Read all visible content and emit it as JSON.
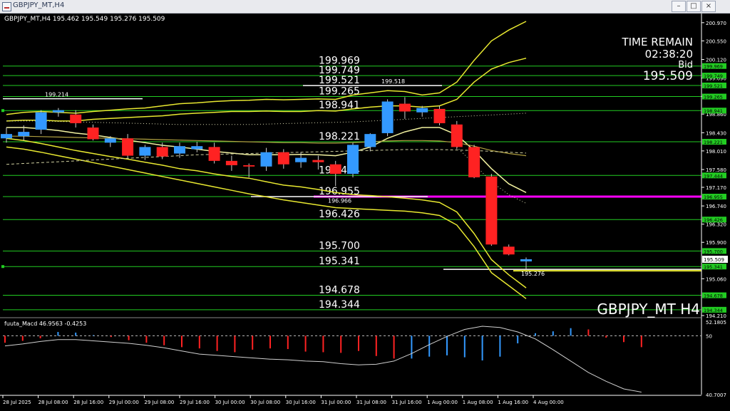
{
  "window": {
    "title": "GBPJPY_MT,H4",
    "min_symbol": "–",
    "max_symbol": "□",
    "close_symbol": "×"
  },
  "main_header": "GBPJPY_MT,H4  195.462 195.549 195.276 195.509",
  "watermark": "GBPJPY_MT H4",
  "info_panel": {
    "label1": "TIME REMAIN",
    "value1": "02:38:20",
    "label2": "Bid",
    "value2": "195.509"
  },
  "macd_header": "fuuta_Macd 46.9563  -0.4253",
  "colors": {
    "bull": "#3399ff",
    "bear": "#ff2222",
    "level": "#22cc22",
    "band": "#e8e830",
    "magenta": "#ff00ff",
    "bg": "#000000",
    "grid_text": "#ffffff"
  },
  "chart_data": {
    "type": "candlestick",
    "symbol": "GBPJPY_MT",
    "timeframe": "H4",
    "ylim": [
      194.21,
      201.0
    ],
    "price_axis_ticks": [
      "200.970",
      "200.550",
      "200.120",
      "199.690",
      "199.270",
      "198.860",
      "198.430",
      "198.010",
      "197.580",
      "197.170",
      "196.740",
      "196.320",
      "195.900",
      "195.060",
      "194.210"
    ],
    "x_ticks": [
      "28 Jul 2025",
      "28 Jul 08:00",
      "28 Jul 16:00",
      "29 Jul 00:00",
      "29 Jul 08:00",
      "29 Jul 16:00",
      "30 Jul 00:00",
      "30 Jul 08:00",
      "30 Jul 16:00",
      "31 Jul 00:00",
      "31 Jul 08:00",
      "31 Jul 16:00",
      "1 Aug 00:00",
      "1 Aug 08:00",
      "1 Aug 16:00",
      "4 Aug 00:00"
    ],
    "candles": [
      {
        "o": 198.3,
        "h": 198.55,
        "l": 198.2,
        "c": 198.4
      },
      {
        "o": 198.35,
        "h": 198.6,
        "l": 198.25,
        "c": 198.45
      },
      {
        "o": 198.5,
        "h": 198.95,
        "l": 198.4,
        "c": 198.9
      },
      {
        "o": 198.9,
        "h": 199.0,
        "l": 198.8,
        "c": 198.95
      },
      {
        "o": 198.85,
        "h": 198.95,
        "l": 198.55,
        "c": 198.65
      },
      {
        "o": 198.55,
        "h": 198.62,
        "l": 198.25,
        "c": 198.28
      },
      {
        "o": 198.2,
        "h": 198.35,
        "l": 198.1,
        "c": 198.3
      },
      {
        "o": 198.3,
        "h": 198.4,
        "l": 197.85,
        "c": 197.9
      },
      {
        "o": 197.9,
        "h": 198.15,
        "l": 197.8,
        "c": 198.1
      },
      {
        "o": 198.1,
        "h": 198.2,
        "l": 197.82,
        "c": 197.88
      },
      {
        "o": 197.95,
        "h": 198.2,
        "l": 197.85,
        "c": 198.12
      },
      {
        "o": 198.05,
        "h": 198.22,
        "l": 197.98,
        "c": 198.12
      },
      {
        "o": 198.1,
        "h": 198.2,
        "l": 197.72,
        "c": 197.78
      },
      {
        "o": 197.78,
        "h": 197.9,
        "l": 197.55,
        "c": 197.68
      },
      {
        "o": 197.68,
        "h": 197.72,
        "l": 197.4,
        "c": 197.65
      },
      {
        "o": 197.65,
        "h": 198.08,
        "l": 197.55,
        "c": 197.98
      },
      {
        "o": 197.98,
        "h": 198.05,
        "l": 197.6,
        "c": 197.7
      },
      {
        "o": 197.75,
        "h": 197.98,
        "l": 197.62,
        "c": 197.85
      },
      {
        "o": 197.8,
        "h": 197.9,
        "l": 197.58,
        "c": 197.75
      },
      {
        "o": 197.7,
        "h": 197.78,
        "l": 197.2,
        "c": 197.48
      },
      {
        "o": 197.48,
        "h": 198.2,
        "l": 197.4,
        "c": 198.15
      },
      {
        "o": 198.1,
        "h": 198.42,
        "l": 198.0,
        "c": 198.4
      },
      {
        "o": 198.42,
        "h": 199.2,
        "l": 198.35,
        "c": 199.15
      },
      {
        "o": 199.1,
        "h": 199.25,
        "l": 198.75,
        "c": 198.92
      },
      {
        "o": 198.9,
        "h": 199.05,
        "l": 198.8,
        "c": 199.0
      },
      {
        "o": 198.98,
        "h": 199.05,
        "l": 198.6,
        "c": 198.65
      },
      {
        "o": 198.62,
        "h": 198.7,
        "l": 198.05,
        "c": 198.1
      },
      {
        "o": 198.1,
        "h": 198.15,
        "l": 197.38,
        "c": 197.4
      },
      {
        "o": 197.42,
        "h": 197.48,
        "l": 195.82,
        "c": 195.85
      },
      {
        "o": 195.8,
        "h": 195.85,
        "l": 195.6,
        "c": 195.62
      },
      {
        "o": 195.46,
        "h": 195.55,
        "l": 195.28,
        "c": 195.51
      }
    ],
    "levels": [
      {
        "price": 199.969,
        "label": "199.969"
      },
      {
        "price": 199.749,
        "label": "199.749"
      },
      {
        "price": 199.521,
        "label": "199.521"
      },
      {
        "price": 199.265,
        "label": "199.265"
      },
      {
        "price": 198.941,
        "label": "198.941"
      },
      {
        "price": 198.221,
        "label": "198.221"
      },
      {
        "price": 197.444,
        "label": "197.444"
      },
      {
        "price": 196.955,
        "label": "196.955"
      },
      {
        "price": 196.426,
        "label": "196.426"
      },
      {
        "price": 195.7,
        "label": "195.700"
      },
      {
        "price": 195.341,
        "label": "195.341"
      },
      {
        "price": 194.678,
        "label": "194.678"
      },
      {
        "price": 194.344,
        "label": "194.344"
      }
    ],
    "current_price": {
      "price": 195.509,
      "label": "195.509"
    },
    "annotations": [
      {
        "price": 199.214,
        "label": "199.214"
      },
      {
        "price": 199.518,
        "label": "199.518"
      },
      {
        "price": 196.966,
        "label": "196.966"
      },
      {
        "price": 195.276,
        "label": "195.276"
      }
    ],
    "band_upper_outer": [
      198.85,
      198.9,
      198.92,
      198.9,
      198.88,
      198.92,
      198.95,
      198.98,
      199.0,
      199.05,
      199.1,
      199.12,
      199.15,
      199.17,
      199.18,
      199.2,
      199.19,
      199.2,
      199.21,
      199.2,
      199.3,
      199.35,
      199.4,
      199.38,
      199.3,
      199.35,
      199.6,
      200.1,
      200.55,
      200.8,
      201.0
    ],
    "band_upper_inner": [
      198.7,
      198.72,
      198.72,
      198.7,
      198.7,
      198.74,
      198.76,
      198.78,
      198.8,
      198.82,
      198.86,
      198.88,
      198.9,
      198.92,
      198.92,
      198.93,
      198.92,
      198.92,
      198.94,
      198.93,
      198.98,
      199.02,
      199.05,
      199.05,
      199.02,
      199.05,
      199.2,
      199.6,
      199.9,
      200.05,
      200.15
    ],
    "band_mid": [
      198.55,
      198.55,
      198.52,
      198.48,
      198.42,
      198.38,
      198.32,
      198.26,
      198.2,
      198.14,
      198.1,
      198.05,
      198.0,
      197.96,
      197.92,
      197.92,
      197.92,
      197.93,
      197.92,
      197.9,
      197.98,
      198.1,
      198.3,
      198.45,
      198.55,
      198.55,
      198.38,
      198.02,
      197.6,
      197.25,
      197.05
    ],
    "band_lower_inner": [
      198.3,
      198.25,
      198.18,
      198.1,
      198.02,
      197.95,
      197.88,
      197.82,
      197.75,
      197.68,
      197.6,
      197.55,
      197.48,
      197.42,
      197.38,
      197.3,
      197.22,
      197.18,
      197.12,
      197.05,
      197.0,
      196.98,
      196.95,
      196.92,
      196.88,
      196.82,
      196.6,
      196.1,
      195.5,
      195.15,
      194.85
    ],
    "band_lower_outer": [
      198.1,
      198.05,
      197.98,
      197.9,
      197.82,
      197.74,
      197.66,
      197.58,
      197.5,
      197.42,
      197.34,
      197.26,
      197.18,
      197.1,
      197.02,
      196.95,
      196.88,
      196.82,
      196.76,
      196.7,
      196.68,
      196.66,
      196.64,
      196.62,
      196.58,
      196.52,
      196.3,
      195.8,
      195.2,
      194.9,
      194.6
    ],
    "ma_long": [
      198.35,
      198.35,
      198.34,
      198.33,
      198.32,
      198.31,
      198.3,
      198.29,
      198.28,
      198.27,
      198.26,
      198.25,
      198.24,
      198.23,
      198.22,
      198.21,
      198.2,
      198.2,
      198.19,
      198.19,
      198.2,
      198.22,
      198.24,
      198.25,
      198.25,
      198.24,
      198.2,
      198.12,
      198.02,
      197.95,
      197.9
    ],
    "ma_dash": [
      197.7,
      197.72,
      197.74,
      197.76,
      197.78,
      197.8,
      197.82,
      197.84,
      197.86,
      197.88,
      197.9,
      197.92,
      197.93,
      197.94,
      197.95,
      197.96,
      197.97,
      197.98,
      197.99,
      198.0,
      198.01,
      198.02,
      198.03,
      198.04,
      198.04,
      198.04,
      198.03,
      198.02,
      198.0,
      197.98,
      197.96
    ],
    "ma_dot_upper": [
      198.7,
      198.7,
      198.7,
      198.69,
      198.68,
      198.67,
      198.66,
      198.65,
      198.64,
      198.63,
      198.62,
      198.62,
      198.62,
      198.62,
      198.62,
      198.63,
      198.64,
      198.65,
      198.66,
      198.67,
      198.68,
      198.7,
      198.72,
      198.74,
      198.76,
      198.78,
      198.8,
      198.82,
      198.84,
      198.86,
      198.88
    ],
    "ma_dot_lower": [
      null,
      null,
      null,
      null,
      null,
      null,
      null,
      null,
      null,
      null,
      null,
      null,
      null,
      null,
      null,
      null,
      null,
      null,
      null,
      null,
      null,
      null,
      null,
      null,
      null,
      null,
      198.1,
      197.7,
      197.3,
      197.0,
      196.8
    ],
    "macd": {
      "ylim": [
        40.7007,
        52.1805
      ],
      "ticks": [
        "52.1805",
        "50",
        "40.7007"
      ],
      "zero_level": 50,
      "signal": [
        48.4,
        48.7,
        49.1,
        49.4,
        49.4,
        49.2,
        49.0,
        48.8,
        48.5,
        48.1,
        47.6,
        47.1,
        46.9,
        46.7,
        46.5,
        46.3,
        46.2,
        46.0,
        45.9,
        45.6,
        45.4,
        45.5,
        46.0,
        47.2,
        48.6,
        49.9,
        51.0,
        51.5,
        51.3,
        50.6,
        49.5,
        47.8,
        46.0,
        44.2,
        42.8,
        41.6,
        41.1
      ],
      "histogram": [
        48.9,
        49.2,
        49.6,
        50.6,
        50.5,
        50.1,
        49.8,
        49.3,
        48.9,
        48.5,
        48.2,
        48.0,
        47.6,
        47.4,
        47.8,
        48.0,
        47.9,
        47.5,
        47.4,
        47.3,
        47.6,
        46.8,
        46.4,
        46.4,
        46.7,
        46.9,
        46.6,
        46.1,
        46.7,
        48.8,
        50.4,
        50.7,
        51.2,
        51.0,
        49.7,
        49.0,
        48.2
      ],
      "hist_colors": [
        "bear",
        "bear",
        "bear",
        "bull",
        "bull",
        "bull",
        "bear",
        "bear",
        "bear",
        "bear",
        "bear",
        "bear",
        "bear",
        "bear",
        "bear",
        "bear",
        "bear",
        "bear",
        "bear",
        "bear",
        "bear",
        "bear",
        "bear",
        "bull",
        "bull",
        "bull",
        "bull",
        "bull",
        "bull",
        "bull",
        "bull",
        "bull",
        "bull",
        "bear",
        "bear",
        "bear",
        "bear"
      ]
    }
  }
}
